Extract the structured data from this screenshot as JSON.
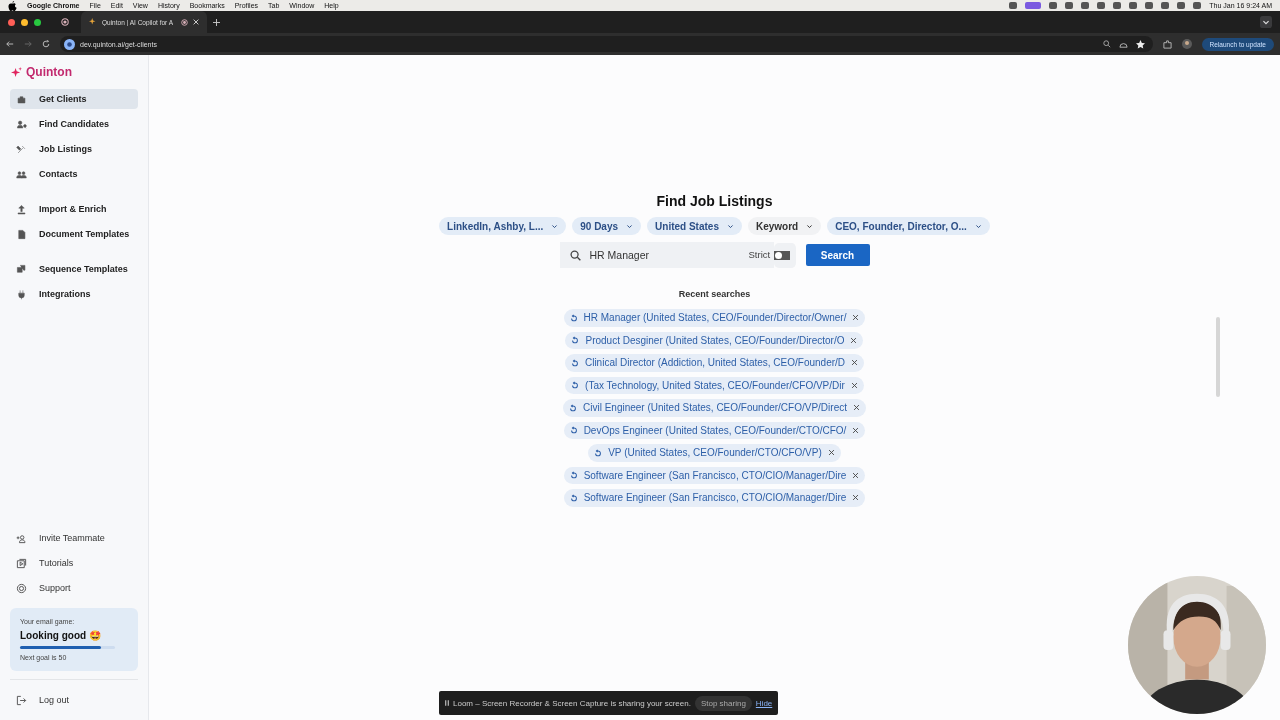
{
  "menu_bar": {
    "app": "Google Chrome",
    "items": [
      "File",
      "Edit",
      "View",
      "History",
      "Bookmarks",
      "Profiles",
      "Tab",
      "Window",
      "Help"
    ],
    "clock": "Thu Jan 16  9:24 AM"
  },
  "browser": {
    "tab_title": "Quinton | AI Copilot for A",
    "url": "dev.quinton.ai/get-clients",
    "relaunch": "Relaunch to update"
  },
  "sidebar": {
    "logo": "Quinton",
    "sections": [
      {
        "items": [
          {
            "label": "Get Clients",
            "selected": true
          },
          {
            "label": "Find Candidates",
            "selected": false
          },
          {
            "label": "Job Listings",
            "selected": false
          },
          {
            "label": "Contacts",
            "selected": false
          }
        ]
      },
      {
        "items": [
          {
            "label": "Import & Enrich",
            "selected": false
          },
          {
            "label": "Document Templates",
            "selected": false
          }
        ]
      },
      {
        "items": [
          {
            "label": "Sequence Templates",
            "selected": false
          },
          {
            "label": "Integrations",
            "selected": false
          }
        ]
      }
    ],
    "bottom_items": [
      "Invite Teammate",
      "Tutorials",
      "Support"
    ],
    "email_game": {
      "caption": "Your email game:",
      "status": "Looking good 🤩",
      "level": 0.85,
      "goal": "Next goal is 50"
    },
    "logout": "Log out"
  },
  "main": {
    "title": "Find Job Listings",
    "filters": [
      {
        "label": "LinkedIn, Ashby, L...",
        "active": true
      },
      {
        "label": "90 Days",
        "active": true
      },
      {
        "label": "United States",
        "active": true
      },
      {
        "label": "Keyword",
        "active": false
      },
      {
        "label": "CEO, Founder, Director, O...",
        "active": true
      }
    ],
    "search": {
      "value": "HR Manager",
      "strict_label": "Strict",
      "strict_on": false,
      "button": "Search"
    },
    "recent_title": "Recent searches",
    "recent": [
      "HR Manager (United States, CEO/Founder/Director/Owner/",
      "Product Desginer (United States, CEO/Founder/Director/O",
      "Clinical Director (Addiction, United States, CEO/Founder/D",
      "(Tax Technology, United States, CEO/Founder/CFO/VP/Dir",
      "Civil Engineer (United States, CEO/Founder/CFO/VP/Direct",
      "DevOps Engineer (United States, CEO/Founder/CTO/CFO/",
      "VP (United States, CEO/Founder/CTO/CFO/VP)",
      "Software Engineer (San Francisco, CTO/CIO/Manager/Dire",
      "Software Engineer (San Francisco, CTO/CIO/Manager/Dire"
    ]
  },
  "share_bar": {
    "message": "Loom – Screen Recorder & Screen Capture is sharing your screen.",
    "stop": "Stop sharing",
    "hide": "Hide"
  }
}
